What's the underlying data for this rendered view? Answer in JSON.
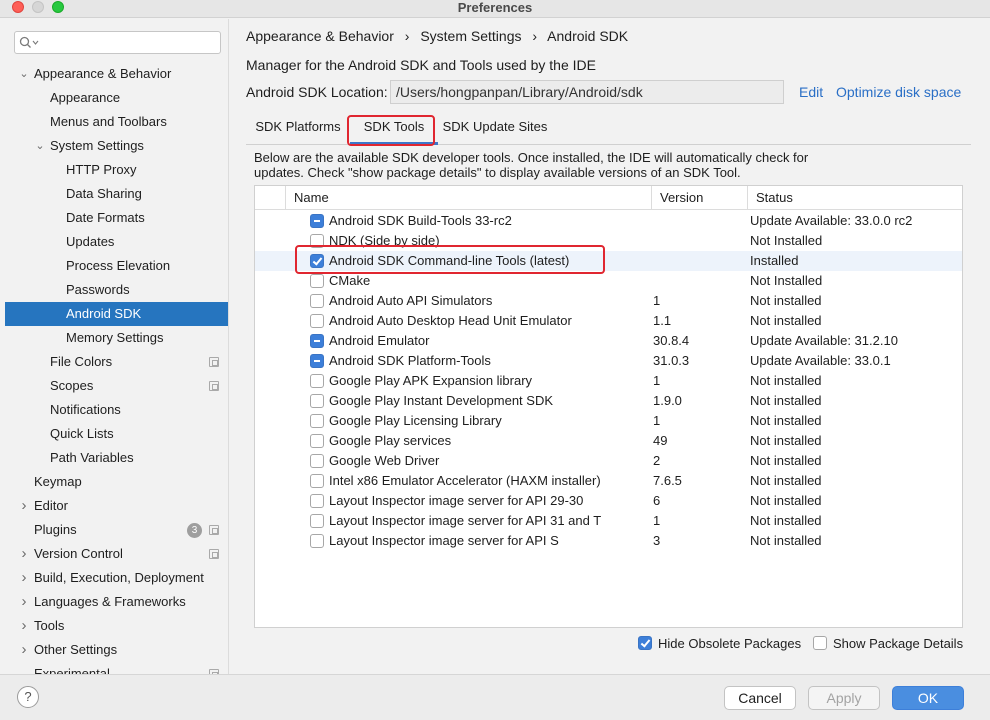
{
  "window": {
    "title": "Preferences"
  },
  "search": {
    "placeholder": ""
  },
  "sidebar": {
    "items": [
      {
        "label": "Appearance & Behavior",
        "expanded": true
      },
      {
        "label": "Appearance"
      },
      {
        "label": "Menus and Toolbars"
      },
      {
        "label": "System Settings",
        "expanded": true
      },
      {
        "label": "HTTP Proxy"
      },
      {
        "label": "Data Sharing"
      },
      {
        "label": "Date Formats"
      },
      {
        "label": "Updates"
      },
      {
        "label": "Process Elevation"
      },
      {
        "label": "Passwords"
      },
      {
        "label": "Android SDK",
        "selected": true
      },
      {
        "label": "Memory Settings"
      },
      {
        "label": "File Colors"
      },
      {
        "label": "Scopes"
      },
      {
        "label": "Notifications"
      },
      {
        "label": "Quick Lists"
      },
      {
        "label": "Path Variables"
      },
      {
        "label": "Keymap"
      },
      {
        "label": "Editor"
      },
      {
        "label": "Plugins",
        "badge": "3"
      },
      {
        "label": "Version Control"
      },
      {
        "label": "Build, Execution, Deployment"
      },
      {
        "label": "Languages & Frameworks"
      },
      {
        "label": "Tools"
      },
      {
        "label": "Other Settings"
      },
      {
        "label": "Experimental"
      }
    ]
  },
  "breadcrumb": [
    "Appearance & Behavior",
    "›",
    "System Settings",
    "›",
    "Android SDK"
  ],
  "description": "Manager for the Android SDK and Tools used by the IDE",
  "sdk_location": {
    "label": "Android SDK Location:",
    "value": "/Users/hongpanpan/Library/Android/sdk",
    "edit": "Edit",
    "optimize": "Optimize disk space"
  },
  "tabs": [
    {
      "label": "SDK Platforms"
    },
    {
      "label": "SDK Tools",
      "active": true
    },
    {
      "label": "SDK Update Sites"
    }
  ],
  "intro": "Below are the available SDK developer tools. Once installed, the IDE will automatically check for updates. Check \"show package details\" to display available versions of an SDK Tool.",
  "table": {
    "columns": [
      "Name",
      "Version",
      "Status"
    ],
    "rows": [
      {
        "state": "partial",
        "name": "Android SDK Build-Tools 33-rc2",
        "version": "",
        "status": "Update Available: 33.0.0 rc2"
      },
      {
        "state": "unchecked",
        "name": "NDK (Side by side)",
        "version": "",
        "status": "Not Installed"
      },
      {
        "state": "checked",
        "name": "Android SDK Command-line Tools (latest)",
        "version": "",
        "status": "Installed"
      },
      {
        "state": "unchecked",
        "name": "CMake",
        "version": "",
        "status": "Not Installed"
      },
      {
        "state": "unchecked",
        "name": "Android Auto API Simulators",
        "version": "1",
        "status": "Not installed"
      },
      {
        "state": "unchecked",
        "name": "Android Auto Desktop Head Unit Emulator",
        "version": "1.1",
        "status": "Not installed"
      },
      {
        "state": "partial",
        "name": "Android Emulator",
        "version": "30.8.4",
        "status": "Update Available: 31.2.10"
      },
      {
        "state": "partial",
        "name": "Android SDK Platform-Tools",
        "version": "31.0.3",
        "status": "Update Available: 33.0.1"
      },
      {
        "state": "unchecked",
        "name": "Google Play APK Expansion library",
        "version": "1",
        "status": "Not installed"
      },
      {
        "state": "unchecked",
        "name": "Google Play Instant Development SDK",
        "version": "1.9.0",
        "status": "Not installed"
      },
      {
        "state": "unchecked",
        "name": "Google Play Licensing Library",
        "version": "1",
        "status": "Not installed"
      },
      {
        "state": "unchecked",
        "name": "Google Play services",
        "version": "49",
        "status": "Not installed"
      },
      {
        "state": "unchecked",
        "name": "Google Web Driver",
        "version": "2",
        "status": "Not installed"
      },
      {
        "state": "unchecked",
        "name": "Intel x86 Emulator Accelerator (HAXM installer)",
        "version": "7.6.5",
        "status": "Not installed"
      },
      {
        "state": "unchecked",
        "name": "Layout Inspector image server for API 29-30",
        "version": "6",
        "status": "Not installed"
      },
      {
        "state": "unchecked",
        "name": "Layout Inspector image server for API 31 and T",
        "version": "1",
        "status": "Not installed"
      },
      {
        "state": "unchecked",
        "name": "Layout Inspector image server for API S",
        "version": "3",
        "status": "Not installed"
      }
    ]
  },
  "options": {
    "hide_obsolete": {
      "label": "Hide Obsolete Packages",
      "checked": true
    },
    "show_details": {
      "label": "Show Package Details",
      "checked": false
    }
  },
  "buttons": {
    "help": "?",
    "cancel": "Cancel",
    "apply": "Apply",
    "ok": "OK"
  },
  "colors": {
    "selection": "#2675bf",
    "highlight_box": "#e02630",
    "link": "#2a6fc6",
    "primary": "#4a8ee0"
  }
}
